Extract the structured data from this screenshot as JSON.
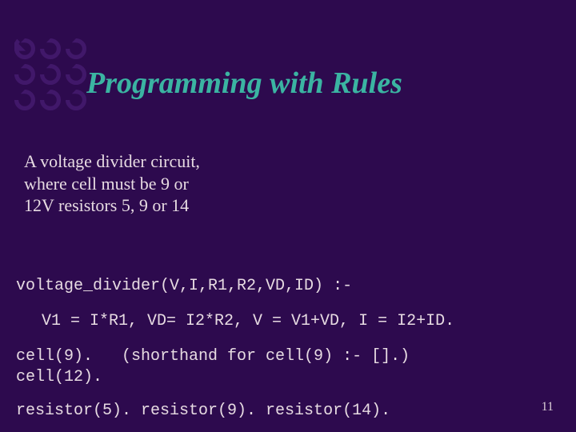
{
  "title": "Programming with Rules",
  "description": "A voltage divider circuit, where cell must be 9 or 12V resistors 5, 9 or 14",
  "code": {
    "line1": "voltage_divider(V,I,R1,R2,VD,ID) :-",
    "line2": "V1 = I*R1, VD= I2*R2, V = V1+VD, I = I2+ID.",
    "line3": "cell(9).   (shorthand for cell(9) :- [].)",
    "line4": "cell(12).",
    "line5": "resistor(5). resistor(9). resistor(14)."
  },
  "page_number": "11",
  "icon": "recycle-arrows-icon"
}
